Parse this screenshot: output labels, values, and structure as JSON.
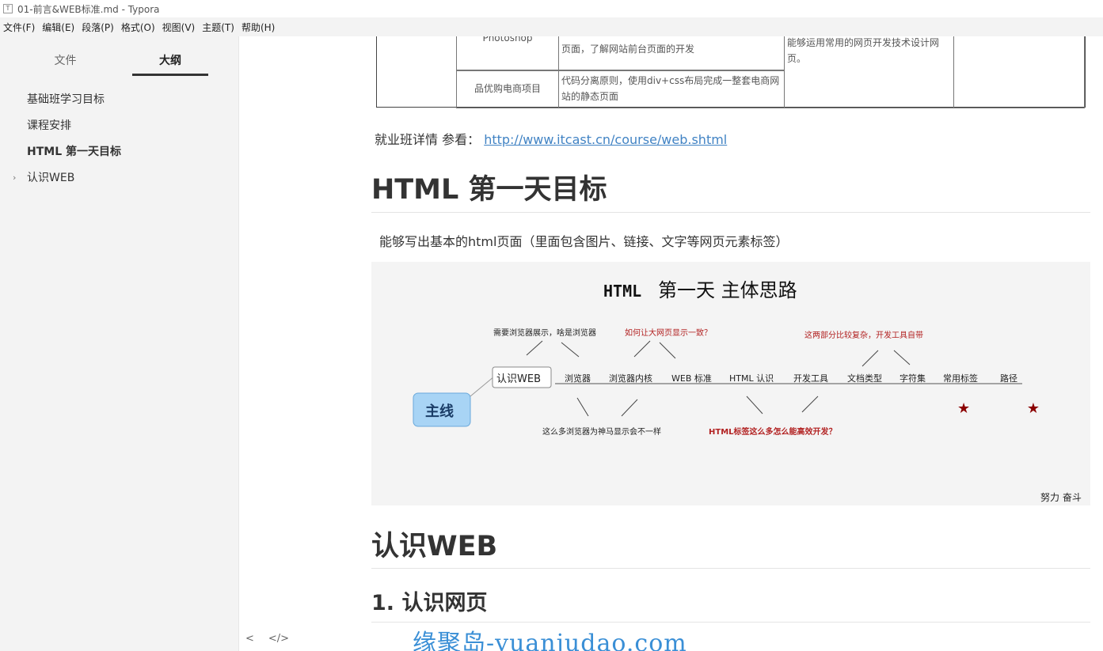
{
  "window": {
    "icon": "typora-icon",
    "title": "01-前言&WEB标准.md - Typora"
  },
  "menu": [
    "文件(F)",
    "编辑(E)",
    "段落(P)",
    "格式(O)",
    "视图(V)",
    "主题(T)",
    "帮助(H)"
  ],
  "sidebar": {
    "tabs": [
      {
        "label": "文件",
        "active": false
      },
      {
        "label": "大纲",
        "active": true
      }
    ],
    "outline": [
      {
        "label": "基础班学习目标",
        "bold": false,
        "expandable": false
      },
      {
        "label": "课程安排",
        "bold": false,
        "expandable": false
      },
      {
        "label": "HTML 第一天目标",
        "bold": true,
        "expandable": false
      },
      {
        "label": "认识WEB",
        "bold": false,
        "expandable": true
      }
    ],
    "footer": {
      "collapse": "<",
      "source_mode": "</>"
    }
  },
  "content": {
    "table": {
      "row_top": {
        "col2": "Photoshop",
        "col3": "页面，了解网站前台页面的开发",
        "col4": "能够运用常用的网页开发技术设计网页。"
      },
      "row_bot": {
        "col2": "品优购电商项目",
        "col3": "代码分离原则，使用div+css布局完成一整套电商网站的静态页面"
      }
    },
    "job_class": {
      "label": "就业班详情 参看：",
      "link": "http://www.itcast.cn/course/web.shtml"
    },
    "h1_day1": "HTML 第一天目标",
    "day1_goal": "能够写出基本的html页面（里面包含图片、链接、文字等网页元素标签）",
    "mindmap": {
      "title_html": "HTML",
      "title_rest": "第一天 主体思路",
      "main_node": "主线",
      "root_node": "认识WEB",
      "chain": [
        "浏览器",
        "浏览器内核",
        "WEB 标准",
        "HTML 认识",
        "开发工具",
        "文档类型",
        "字符集",
        "常用标签",
        "路径"
      ],
      "note_browser_top": "需要浏览器展示，啥是浏览器",
      "note_standard": "如何让大网页显示一致？",
      "note_complex": "这两部分比较复杂，开发工具自带",
      "note_bottom_browser": "这么多浏览器为神马显示会不一样",
      "note_bottom_html": "HTML标签这么多怎么能高效开发？",
      "stars": "★ ★",
      "signature": "努力 奋斗",
      "colors": {
        "accent_red": "#b22222",
        "node_blue": "#a8d4f5",
        "star": "#8b0000"
      }
    },
    "h1_web": "认识WEB",
    "h2_webpage": "1. 认识网页",
    "watermark": "缘聚岛-yuanjudao.com"
  }
}
